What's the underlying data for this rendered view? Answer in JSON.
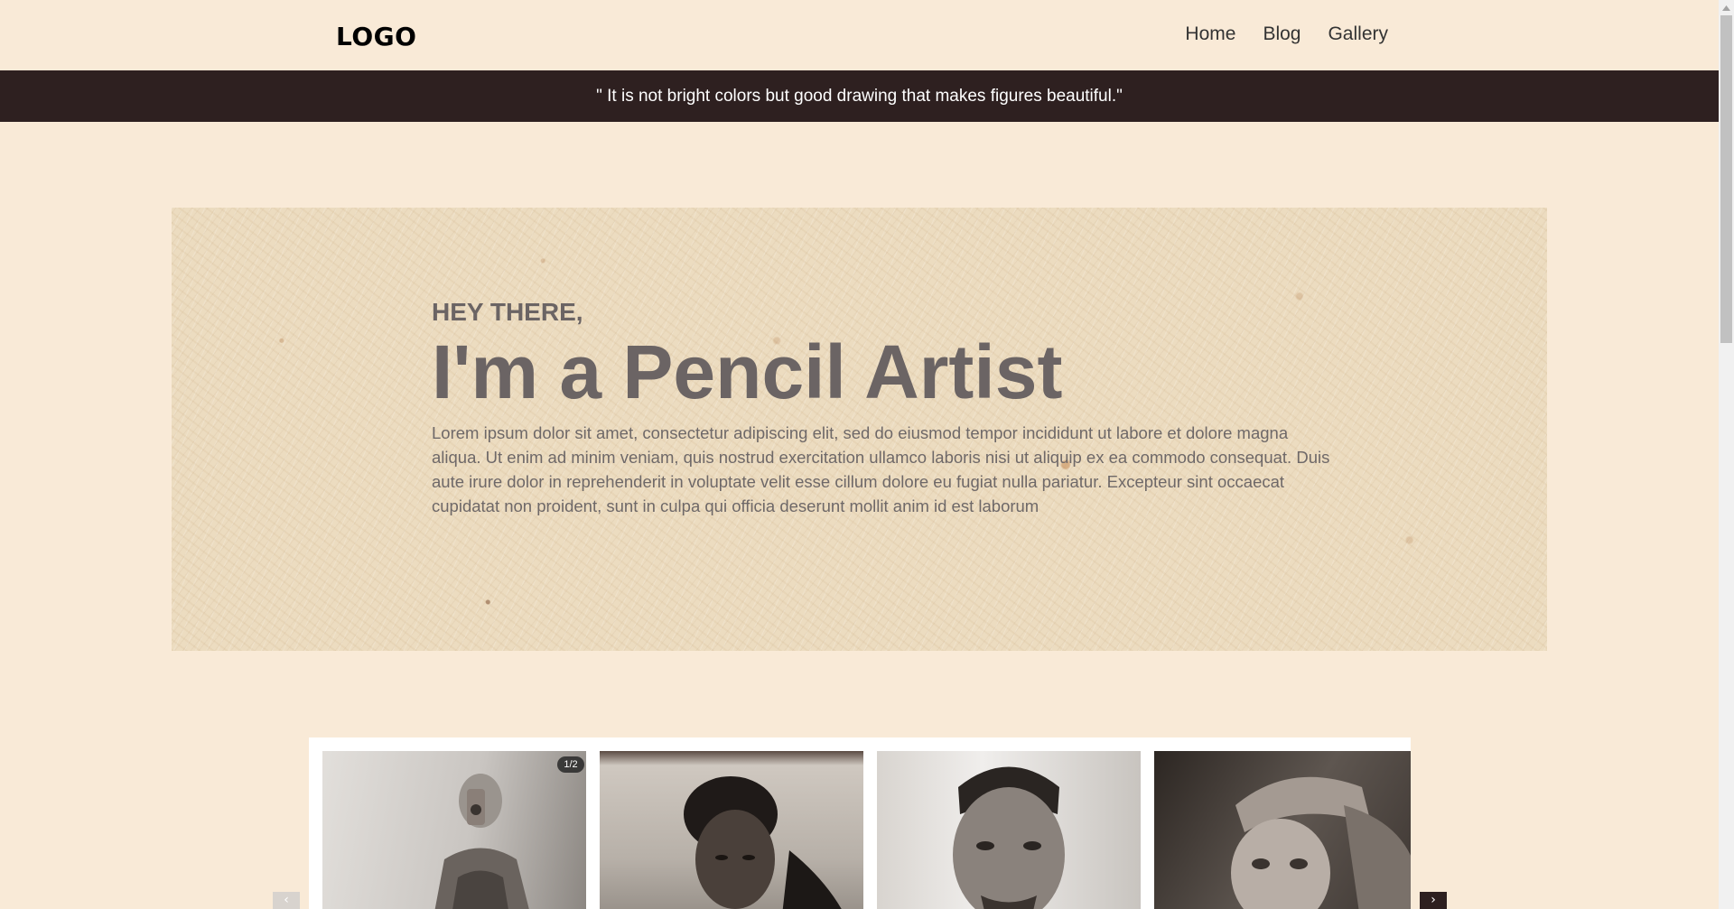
{
  "header": {
    "logo": "LOGO",
    "nav": [
      {
        "label": "Home"
      },
      {
        "label": "Blog"
      },
      {
        "label": "Gallery"
      }
    ]
  },
  "quote": "\" It is not bright colors but good drawing that makes figures beautiful.\"",
  "hero": {
    "greeting": "HEY THERE,",
    "title": "I'm a Pencil Artist",
    "text": "Lorem ipsum dolor sit amet, consectetur adipiscing elit, sed do eiusmod tempor incididunt ut labore et dolore magna aliqua. Ut enim ad minim veniam, quis nostrud exercitation ullamco laboris nisi ut aliquip ex ea commodo consequat. Duis aute irure dolor in reprehenderit in voluptate velit esse cillum dolore eu fugiat nulla pariatur. Excepteur sint occaecat cupidatat non proident, sunt in culpa qui officia deserunt mollit anim id est laborum"
  },
  "gallery": {
    "first_badge": "1/2",
    "arrow_prev_icon": "chevron-left-icon",
    "arrow_next_icon": "chevron-right-icon"
  },
  "colors": {
    "background": "#f9ead7",
    "quote_bar": "#2e2020",
    "hero_text": "#6b6464"
  }
}
